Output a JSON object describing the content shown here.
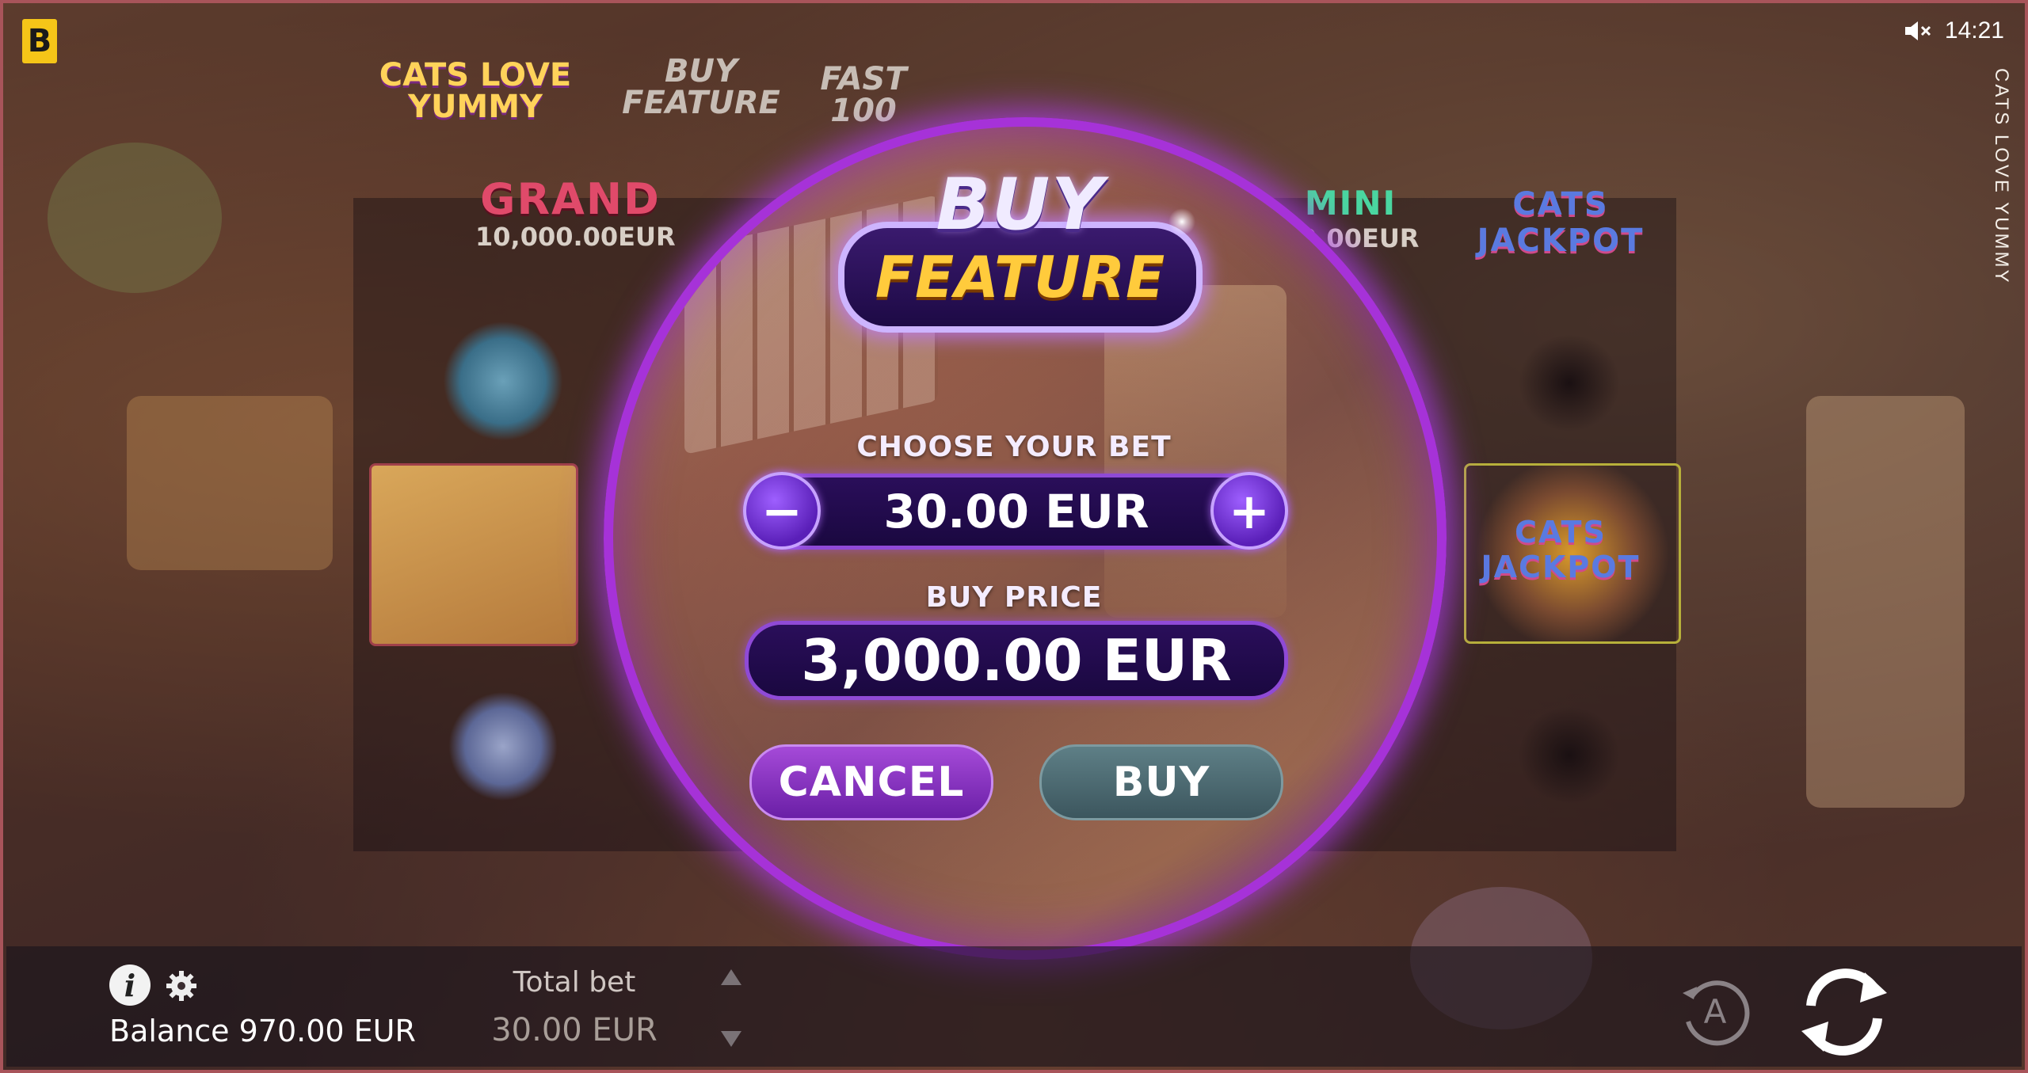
{
  "provider_logo": "B",
  "clock": "14:21",
  "game_title": "CATS LOVE YUMMY",
  "top_logos": {
    "game_logo": "CATS LOVE YUMMY",
    "buy_feature": "BUY FEATURE",
    "fast": "FAST 100"
  },
  "jackpots": {
    "grand_label": "GRAND",
    "grand_value": "10,000.00EUR",
    "mini_label": "MINI",
    "mini_value": "0.00EUR",
    "cats_jackpot_top": "CATS JACKPOT",
    "cats_jackpot_mid": "CATS JACKPOT"
  },
  "modal": {
    "title_top": "BUY",
    "title_bottom": "FEATURE",
    "choose_bet_label": "CHOOSE YOUR BET",
    "bet_value": "30.00 EUR",
    "minus_symbol": "−",
    "plus_symbol": "+",
    "buy_price_label": "BUY PRICE",
    "buy_price_value": "3,000.00 EUR",
    "cancel_label": "CANCEL",
    "buy_label": "BUY"
  },
  "bottom": {
    "info_symbol": "i",
    "balance": "Balance 970.00 EUR",
    "total_bet_label": "Total bet",
    "total_bet_value": "30.00 EUR",
    "autoplay_letter": "A"
  },
  "icons": {
    "mute": "speaker-muted-icon",
    "info": "info-icon",
    "settings": "gear-icon",
    "bet_up": "triangle-up-icon",
    "bet_down": "triangle-down-icon",
    "autoplay": "autoplay-icon",
    "spin": "spin-arrows-icon"
  },
  "colors": {
    "modal_border": "#a632d8",
    "cancel_button": "#8a32c0",
    "buy_button": "#4f6d74",
    "feature_gold": "#ffcb3c",
    "provider_yellow": "#f5c518"
  }
}
